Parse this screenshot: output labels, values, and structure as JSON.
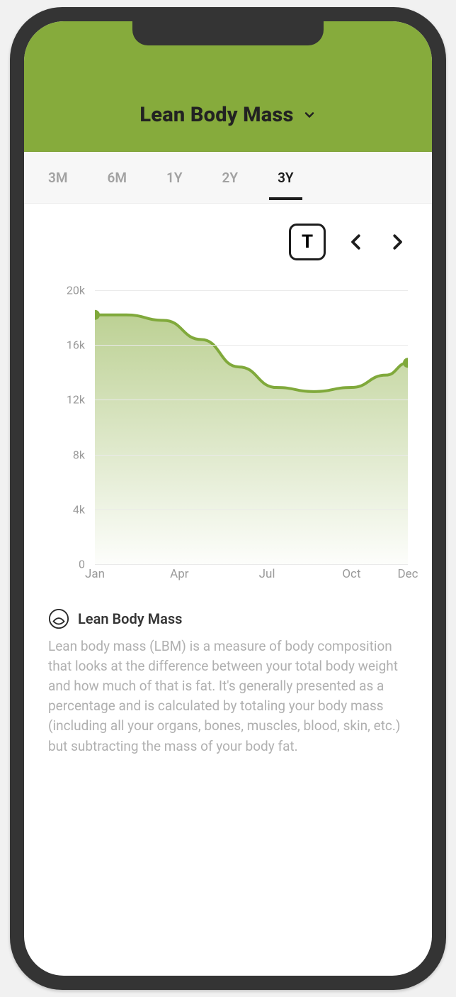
{
  "header": {
    "title": "Lean Body Mass"
  },
  "tabs": [
    {
      "label": "3M",
      "active": false
    },
    {
      "label": "6M",
      "active": false
    },
    {
      "label": "1Y",
      "active": false
    },
    {
      "label": "2Y",
      "active": false
    },
    {
      "label": "3Y",
      "active": true
    }
  ],
  "toolbar": {
    "toggle_label": "T"
  },
  "info": {
    "title": "Lean Body Mass",
    "description": "Lean body mass (LBM) is a measure of body composition that looks at the difference between your total body weight and how much of that is fat. It's generally presented as a percentage and is calculated by totaling your body mass (including all your organs, bones, muscles, blood, skin, etc.) but subtracting the mass of your body fat."
  },
  "colors": {
    "line": "#80a93b",
    "fill_top": "rgba(134,171,60,0.55)",
    "fill_bottom": "rgba(134,171,60,0.02)",
    "point": "#80a93b"
  },
  "chart_data": {
    "type": "area",
    "title": "",
    "xlabel": "",
    "ylabel": "",
    "ylim": [
      0,
      20000
    ],
    "y_ticks": [
      0,
      4000,
      8000,
      12000,
      16000,
      20000
    ],
    "y_tick_labels": [
      "0",
      "4k",
      "8k",
      "12k",
      "16k",
      "20k"
    ],
    "x_tick_labels": [
      "Jan",
      "Apr",
      "Jul",
      "Oct",
      "Dec"
    ],
    "x_tick_positions": [
      0.0,
      0.27,
      0.55,
      0.82,
      1.0
    ],
    "x": [
      0.0,
      0.1,
      0.22,
      0.34,
      0.46,
      0.58,
      0.7,
      0.82,
      0.93,
      1.0
    ],
    "values": [
      18200,
      18200,
      17800,
      16400,
      14400,
      12900,
      12600,
      12900,
      13800,
      14700
    ],
    "endpoints": [
      {
        "x": 0.0,
        "y": 18200
      },
      {
        "x": 1.0,
        "y": 14700
      }
    ],
    "grid": true,
    "legend": false
  }
}
